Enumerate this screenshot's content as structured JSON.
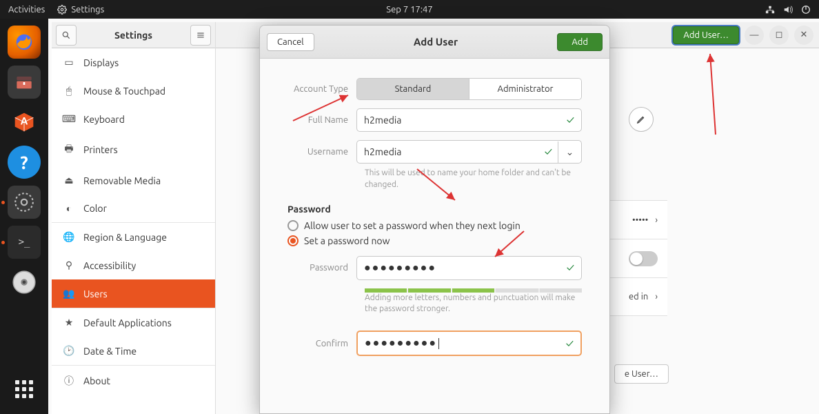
{
  "topbar": {
    "activities": "Activities",
    "app_name": "Settings",
    "clock": "Sep 7  17:47"
  },
  "settings": {
    "title": "Settings",
    "items": [
      {
        "icon": "display-icon",
        "label": "Displays"
      },
      {
        "icon": "mouse-icon",
        "label": "Mouse & Touchpad"
      },
      {
        "icon": "keyboard-icon",
        "label": "Keyboard"
      },
      {
        "icon": "printer-icon",
        "label": "Printers"
      },
      {
        "icon": "removable-icon",
        "label": "Removable Media"
      },
      {
        "icon": "color-icon",
        "label": "Color"
      },
      {
        "icon": "region-icon",
        "label": "Region & Language"
      },
      {
        "icon": "accessibility-icon",
        "label": "Accessibility"
      },
      {
        "icon": "users-icon",
        "label": "Users"
      },
      {
        "icon": "default-apps-icon",
        "label": "Default Applications"
      },
      {
        "icon": "datetime-icon",
        "label": "Date & Time"
      },
      {
        "icon": "about-icon",
        "label": "About"
      }
    ]
  },
  "main_header": {
    "add_user": "Add User…"
  },
  "bg_card": {
    "dots": "•••••",
    "logged_in": "ed in"
  },
  "dialog": {
    "cancel": "Cancel",
    "title": "Add User",
    "add": "Add",
    "account_type_label": "Account Type",
    "standard": "Standard",
    "administrator": "Administrator",
    "fullname_label": "Full Name",
    "fullname_value": "h2media",
    "username_label": "Username",
    "username_value": "h2media",
    "username_hint": "This will be used to name your home folder and can't be changed.",
    "password_heading": "Password",
    "radio_later": "Allow user to set a password when they next login",
    "radio_now": "Set a password now",
    "password_label": "Password",
    "password_dots": "●●●●●●●●●",
    "password_hint": "Adding more letters, numbers and punctuation will make the password stronger.",
    "confirm_label": "Confirm",
    "confirm_dots": "●●●●●●●●●"
  },
  "remove_user": "e User…"
}
